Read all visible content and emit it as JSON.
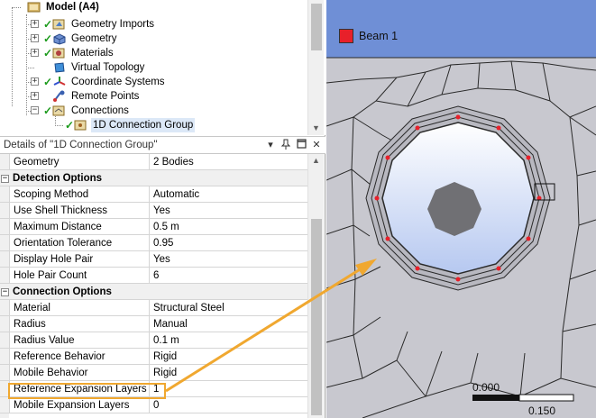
{
  "tree": {
    "items": [
      {
        "label": "Model (A4)",
        "icon": "model-icon"
      },
      {
        "label": "Geometry Imports",
        "icon": "geometry-imports-icon"
      },
      {
        "label": "Geometry",
        "icon": "geometry-icon"
      },
      {
        "label": "Materials",
        "icon": "materials-icon"
      },
      {
        "label": "Virtual Topology",
        "icon": "virtual-topology-icon"
      },
      {
        "label": "Coordinate Systems",
        "icon": "coordinate-systems-icon"
      },
      {
        "label": "Remote Points",
        "icon": "remote-points-icon"
      },
      {
        "label": "Connections",
        "icon": "connections-icon"
      },
      {
        "label": "1D Connection Group",
        "icon": "connection-group-icon"
      }
    ]
  },
  "details": {
    "title": "Details of \"1D Connection Group\"",
    "pin_glyph": "↓",
    "rows": [
      {
        "label": "Geometry",
        "value": "2 Bodies"
      },
      {
        "section": "Detection Options"
      },
      {
        "label": "Scoping Method",
        "value": "Automatic"
      },
      {
        "label": "Use Shell Thickness",
        "value": "Yes"
      },
      {
        "label": "Maximum Distance",
        "value": "0.5 m"
      },
      {
        "label": "Orientation Tolerance",
        "value": "0.95"
      },
      {
        "label": "Display Hole Pair",
        "value": "Yes"
      },
      {
        "label": "Hole Pair Count",
        "value": "6"
      },
      {
        "section": "Connection Options"
      },
      {
        "label": "Material",
        "value": "Structural Steel"
      },
      {
        "label": "Radius",
        "value": "Manual"
      },
      {
        "label": "Radius Value",
        "value": "0.1 m"
      },
      {
        "label": "Reference Behavior",
        "value": "Rigid"
      },
      {
        "label": "Mobile Behavior",
        "value": "Rigid"
      },
      {
        "label": "Reference Expansion Layers",
        "value": "1"
      },
      {
        "label": "Mobile Expansion Layers",
        "value": "0"
      }
    ]
  },
  "viewport": {
    "legend_label": "Beam 1",
    "legend_color": "#e8202a",
    "scale_start": "0.000",
    "scale_end": "0.150",
    "top_color": "#6f8fd6",
    "mesh_color": "#c8c8cf",
    "hole_color": "#d6e0f6"
  },
  "colors": {
    "highlight": "#f0a830",
    "check": "#1a9a1a"
  }
}
